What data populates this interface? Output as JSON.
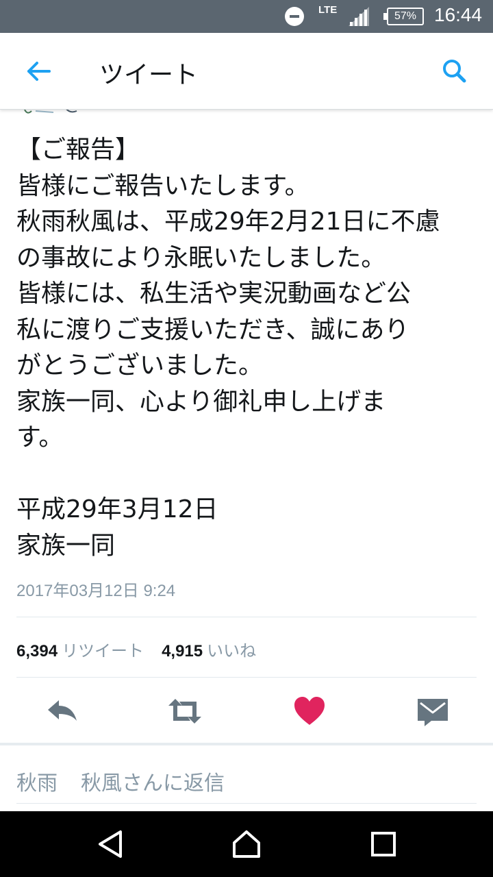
{
  "status_bar": {
    "network": "LTE",
    "battery": "57%",
    "time": "16:44",
    "icons": [
      "do-not-disturb-icon",
      "signal-icon",
      "battery-icon"
    ]
  },
  "header": {
    "title": "ツイート",
    "back_icon": "arrow-left-icon",
    "search_icon": "search-icon",
    "accent_color": "#1da1f2"
  },
  "tweet": {
    "lines": [
      "【ご報告】",
      "皆様にご報告いたします。",
      "秋雨秋風は、平成29年2月21日に不慮",
      "の事故により永眠いたしました。",
      "皆様には、私生活や実況動画など公",
      "私に渡りご支援いただき、誠にあり",
      "がとうございました。",
      "家族一同、心より御礼申し上げま",
      "す。"
    ],
    "signature": [
      "平成29年3月12日",
      "家族一同"
    ],
    "timestamp": "2017年03月12日 9:24"
  },
  "stats": {
    "retweets_count": "6,394",
    "retweets_label": "リツイート",
    "likes_count": "4,915",
    "likes_label": "いいね"
  },
  "actions": {
    "reply_icon": "reply-icon",
    "retweet_icon": "retweet-icon",
    "like_icon": "heart-icon",
    "dm_icon": "envelope-icon",
    "like_color": "#e0245e",
    "icon_color": "#667580"
  },
  "reply_bar": {
    "name_first": "秋雨",
    "name_rest": "秋風さんに返信"
  },
  "nav_bar": {
    "icons": [
      "back-triangle-icon",
      "home-icon",
      "recents-icon"
    ]
  }
}
